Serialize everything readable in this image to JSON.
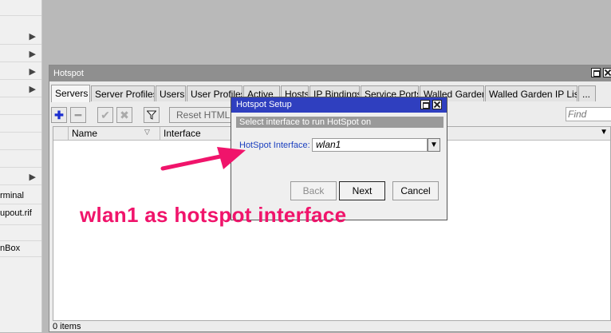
{
  "left_menu": {
    "items": [
      {
        "label": "",
        "arrow": ""
      },
      {
        "label": "",
        "arrow": "▶"
      },
      {
        "label": "",
        "arrow": "▶"
      },
      {
        "label": "",
        "arrow": "▶"
      },
      {
        "label": "",
        "arrow": "▶"
      },
      {
        "label": "",
        "arrow": ""
      },
      {
        "label": "",
        "arrow": ""
      },
      {
        "label": "",
        "arrow": ""
      },
      {
        "label": "",
        "arrow": ""
      },
      {
        "label": "",
        "arrow": ""
      },
      {
        "label": "",
        "arrow": "▶"
      },
      {
        "label": "rminal",
        "arrow": ""
      },
      {
        "label": "upout.rif",
        "arrow": ""
      },
      {
        "label": "",
        "arrow": ""
      },
      {
        "label": "nBox",
        "arrow": ""
      }
    ]
  },
  "hotspot_window": {
    "title": "Hotspot",
    "tabs": [
      "Servers",
      "Server Profiles",
      "Users",
      "User Profiles",
      "Active",
      "Hosts",
      "IP Bindings",
      "Service Ports",
      "Walled Garden",
      "Walled Garden IP List",
      "..."
    ],
    "active_tab": "Servers",
    "toolbar": {
      "add_icon": "plus-icon",
      "remove_icon": "minus-icon",
      "enable_icon": "check-icon",
      "disable_icon": "cross-icon",
      "filter_icon": "filter-icon",
      "reset_html_label": "Reset HTML",
      "find_placeholder": "Find"
    },
    "table": {
      "columns": [
        "Name",
        "Interface"
      ],
      "rows": []
    },
    "status": "0 items"
  },
  "setup_dialog": {
    "title": "Hotspot Setup",
    "hint": "Select interface to run HotSpot on",
    "interface_label": "HotSpot Interface:",
    "interface_value": "wlan1",
    "back_label": "Back",
    "next_label": "Next",
    "cancel_label": "Cancel"
  },
  "annotation": {
    "text": "wlan1 as hotspot interface",
    "color": "#f0146b"
  },
  "colors": {
    "dialog_titlebar": "#2f3fbf",
    "window_titlebar": "#8f8f8f",
    "label_blue": "#1a3fbf"
  }
}
